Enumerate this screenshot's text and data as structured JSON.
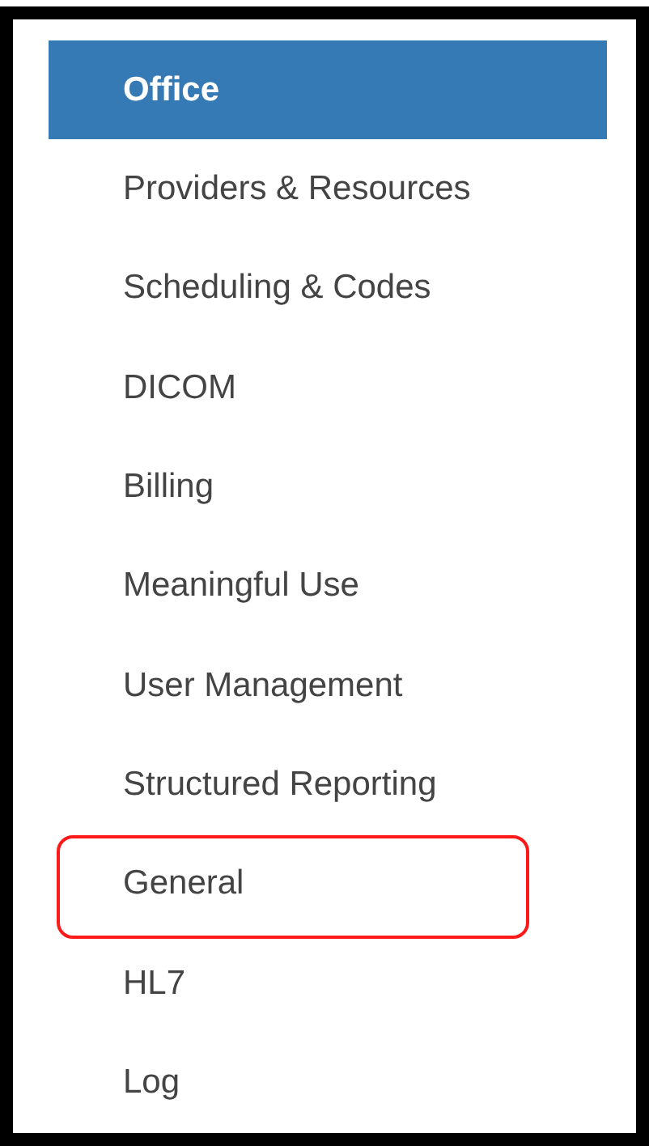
{
  "menu": {
    "items": [
      {
        "label": "Office",
        "selected": true,
        "highlighted": false
      },
      {
        "label": "Providers & Resources",
        "selected": false,
        "highlighted": false
      },
      {
        "label": "Scheduling & Codes",
        "selected": false,
        "highlighted": false
      },
      {
        "label": "DICOM",
        "selected": false,
        "highlighted": false
      },
      {
        "label": "Billing",
        "selected": false,
        "highlighted": false
      },
      {
        "label": "Meaningful Use",
        "selected": false,
        "highlighted": false
      },
      {
        "label": "User Management",
        "selected": false,
        "highlighted": false
      },
      {
        "label": "Structured Reporting",
        "selected": false,
        "highlighted": false
      },
      {
        "label": "General",
        "selected": false,
        "highlighted": true
      },
      {
        "label": "HL7",
        "selected": false,
        "highlighted": false
      },
      {
        "label": "Log",
        "selected": false,
        "highlighted": false
      }
    ]
  }
}
